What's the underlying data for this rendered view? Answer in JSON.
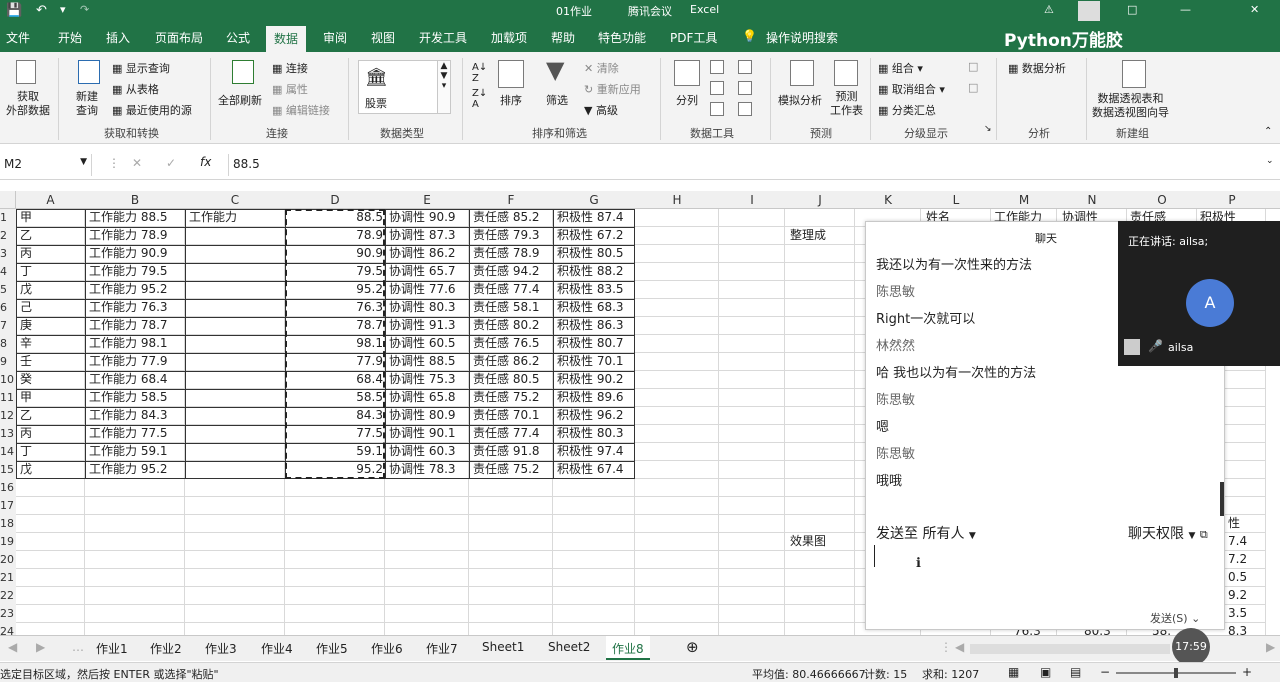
{
  "title_bar": {
    "doc": "01作业",
    "app": "腾讯会议",
    "excel": "Excel"
  },
  "ribbon_tabs": [
    "文件",
    "开始",
    "插入",
    "页面布局",
    "公式",
    "数据",
    "审阅",
    "视图",
    "开发工具",
    "加载项",
    "帮助",
    "特色功能",
    "PDF工具",
    "操作说明搜索"
  ],
  "active_tab": "数据",
  "watermark": "Python万能胶",
  "ribbon": {
    "get_external": "获取\n外部数据",
    "new_query": "新建\n查询",
    "show_query": "显示查询",
    "from_table": "从表格",
    "recent_sources": "最近使用的源",
    "group_get": "获取和转换",
    "refresh_all": "全部刷新",
    "connections": "连接",
    "properties": "属性",
    "edit_links": "编辑链接",
    "group_conn": "连接",
    "stocks": "股票",
    "group_types": "数据类型",
    "sort": "排序",
    "filter": "筛选",
    "clear": "清除",
    "reapply": "重新应用",
    "advanced": "高级",
    "group_sort": "排序和筛选",
    "split": "分列",
    "group_tools": "数据工具",
    "whatif": "模拟分析",
    "forecast": "预测\n工作表",
    "group_forecast": "预测",
    "group_btn": "组合",
    "ungroup_btn": "取消组合",
    "subtotal": "分类汇总",
    "group_outline": "分级显示",
    "data_analysis": "数据分析",
    "group_analysis": "分析",
    "pivot_wizard": "数据透视表和\n数据透视图向导",
    "group_new": "新建组"
  },
  "namebox": "M2",
  "formula": "88.5",
  "columns": [
    "A",
    "B",
    "C",
    "D",
    "E",
    "F",
    "G",
    "H",
    "I",
    "J",
    "K",
    "L",
    "M",
    "N",
    "O",
    "P"
  ],
  "rows": [
    {
      "n": "1",
      "a": "甲",
      "b": "工作能力 88.5",
      "c": "工作能力",
      "d": "88.5",
      "e": "协调性 90.9",
      "f": "责任感 85.2",
      "g": "积极性 87.4"
    },
    {
      "n": "2",
      "a": "乙",
      "b": "工作能力 78.9",
      "c": "",
      "d": "78.9",
      "e": "协调性 87.3",
      "f": "责任感 79.3",
      "g": "积极性 67.2"
    },
    {
      "n": "3",
      "a": "丙",
      "b": "工作能力 90.9",
      "c": "",
      "d": "90.9",
      "e": "协调性 86.2",
      "f": "责任感 78.9",
      "g": "积极性 80.5"
    },
    {
      "n": "4",
      "a": "丁",
      "b": "工作能力 79.5",
      "c": "",
      "d": "79.5",
      "e": "协调性 65.7",
      "f": "责任感 94.2",
      "g": "积极性 88.2"
    },
    {
      "n": "5",
      "a": "戊",
      "b": "工作能力 95.2",
      "c": "",
      "d": "95.2",
      "e": "协调性 77.6",
      "f": "责任感 77.4",
      "g": "积极性 83.5"
    },
    {
      "n": "6",
      "a": "己",
      "b": "工作能力 76.3",
      "c": "",
      "d": "76.3",
      "e": "协调性 80.3",
      "f": "责任感 58.1",
      "g": "积极性 68.3"
    },
    {
      "n": "7",
      "a": "庚",
      "b": "工作能力 78.7",
      "c": "",
      "d": "78.7",
      "e": "协调性 91.3",
      "f": "责任感 80.2",
      "g": "积极性 86.3"
    },
    {
      "n": "8",
      "a": "辛",
      "b": "工作能力 98.1",
      "c": "",
      "d": "98.1",
      "e": "协调性 60.5",
      "f": "责任感 76.5",
      "g": "积极性 80.7"
    },
    {
      "n": "9",
      "a": "壬",
      "b": "工作能力 77.9",
      "c": "",
      "d": "77.9",
      "e": "协调性 88.5",
      "f": "责任感 86.2",
      "g": "积极性 70.1"
    },
    {
      "n": "10",
      "a": "癸",
      "b": "工作能力 68.4",
      "c": "",
      "d": "68.4",
      "e": "协调性 75.3",
      "f": "责任感 80.5",
      "g": "积极性 90.2"
    },
    {
      "n": "11",
      "a": "甲",
      "b": "工作能力 58.5",
      "c": "",
      "d": "58.5",
      "e": "协调性 65.8",
      "f": "责任感 75.2",
      "g": "积极性 89.6"
    },
    {
      "n": "12",
      "a": "乙",
      "b": "工作能力 84.3",
      "c": "",
      "d": "84.3",
      "e": "协调性 80.9",
      "f": "责任感 70.1",
      "g": "积极性 96.2"
    },
    {
      "n": "13",
      "a": "丙",
      "b": "工作能力 77.5",
      "c": "",
      "d": "77.5",
      "e": "协调性 90.1",
      "f": "责任感 77.4",
      "g": "积极性 80.3"
    },
    {
      "n": "14",
      "a": "丁",
      "b": "工作能力 59.1",
      "c": "",
      "d": "59.1",
      "e": "协调性 60.3",
      "f": "责任感 91.8",
      "g": "积极性 97.4"
    },
    {
      "n": "15",
      "a": "戊",
      "b": "工作能力 95.2",
      "c": "",
      "d": "95.2",
      "e": "协调性 78.3",
      "f": "责任感 75.2",
      "g": "积极性 67.4"
    }
  ],
  "empty_rows": [
    "16",
    "17",
    "18",
    "19",
    "20",
    "21",
    "22",
    "23",
    "24"
  ],
  "right_headers": {
    "l": "姓名",
    "m": "工作能力",
    "n": "协调性",
    "o": "责任感",
    "p": "积极性"
  },
  "j2": "整理成",
  "j19": "效果图",
  "p_partial": [
    "性",
    "7.4",
    "7.2",
    "0.5",
    "9.2",
    "3.5",
    "8.3"
  ],
  "row24_partial": {
    "m": "76.3",
    "n": "80.3",
    "o": "58."
  },
  "chat": {
    "title": "聊天",
    "messages": [
      {
        "kind": "msg",
        "text": "我还以为有一次性来的方法"
      },
      {
        "kind": "name",
        "text": "陈思敏"
      },
      {
        "kind": "msg",
        "text": "Right一次就可以"
      },
      {
        "kind": "name",
        "text": "林然然"
      },
      {
        "kind": "msg",
        "text": "哈 我也以为有一次性的方法"
      },
      {
        "kind": "name",
        "text": "陈思敏"
      },
      {
        "kind": "msg",
        "text": "嗯"
      },
      {
        "kind": "name",
        "text": "陈思敏"
      },
      {
        "kind": "msg",
        "text": "哦哦"
      }
    ],
    "send_to": "发送至 所有人",
    "perm": "聊天权限",
    "send_btn": "发送(S)"
  },
  "speaking": {
    "label": "正在讲话: ailsa;",
    "avatar_letter": "A",
    "user": "ailsa"
  },
  "sheets": [
    "作业1",
    "作业2",
    "作业3",
    "作业4",
    "作业5",
    "作业6",
    "作业7",
    "Sheet1",
    "Sheet2",
    "作业8"
  ],
  "active_sheet": "作业8",
  "status": {
    "hint": "选定目标区域，然后按 ENTER 或选择\"粘贴\"",
    "avg": "平均值: 80.46666667",
    "count": "计数: 15",
    "sum": "求和: 1207",
    "time": "17:59"
  }
}
